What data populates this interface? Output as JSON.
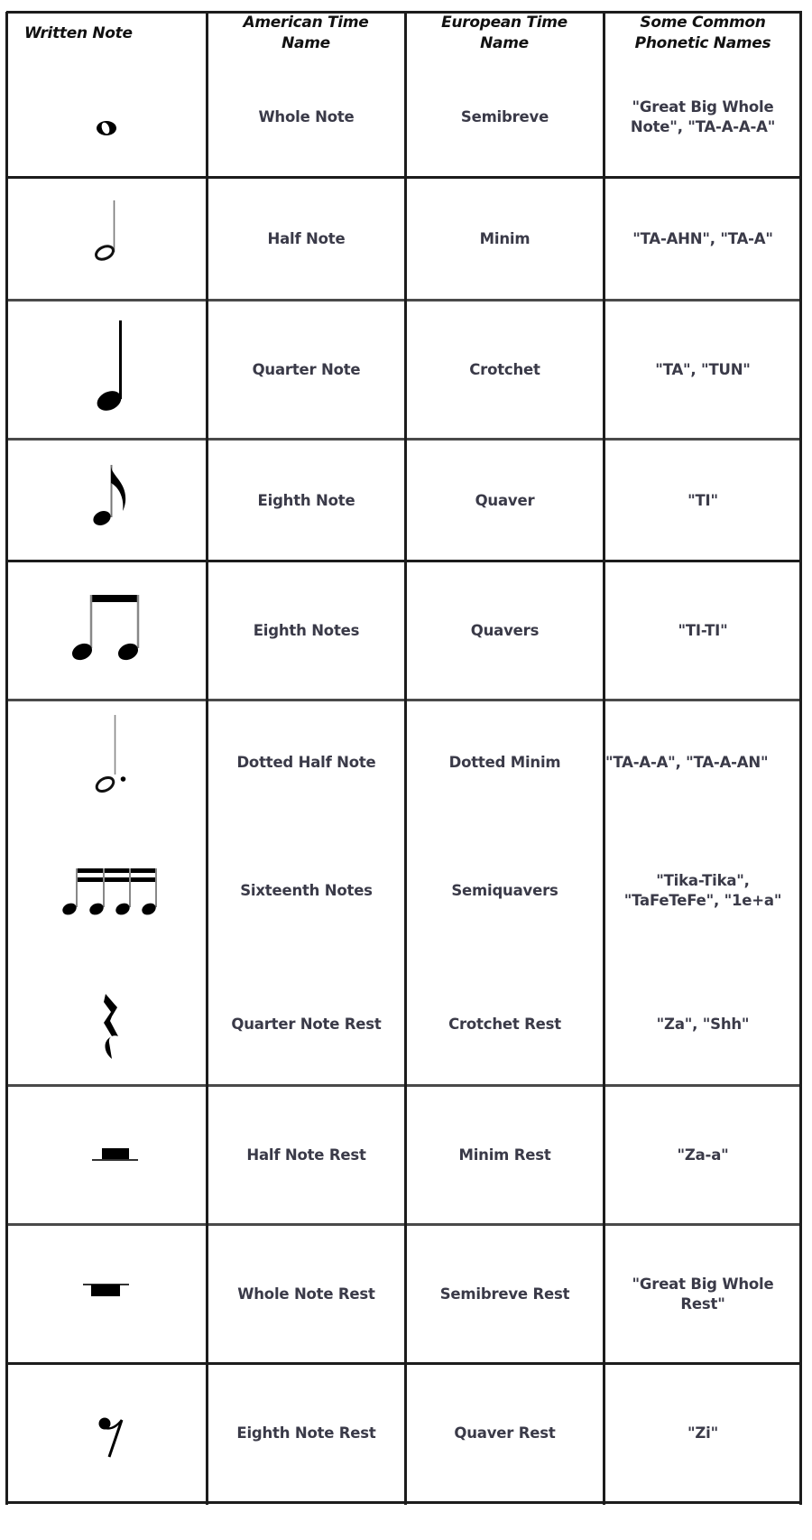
{
  "header": {
    "written_note": "Written Note",
    "american": "American Time Name",
    "european": "European Time Name",
    "phonetic": "Some Common Phonetic Names"
  },
  "rows": [
    {
      "icon": "whole-note-icon",
      "american": "Whole Note",
      "european": "Semibreve",
      "phonetic": "\"Great Big Whole Note\", \"TA-A-A-A\""
    },
    {
      "icon": "half-note-icon",
      "american": "Half Note",
      "european": "Minim",
      "phonetic": "\"TA-AHN\", \"TA-A\""
    },
    {
      "icon": "quarter-note-icon",
      "american": "Quarter Note",
      "european": "Crotchet",
      "phonetic": "\"TA\", \"TUN\""
    },
    {
      "icon": "eighth-note-icon",
      "american": "Eighth Note",
      "european": "Quaver",
      "phonetic": "\"TI\""
    },
    {
      "icon": "beamed-eighth-notes-icon",
      "american": "Eighth Notes",
      "european": "Quavers",
      "phonetic": "\"TI-TI\""
    },
    {
      "icon": "dotted-half-note-icon",
      "american": "Dotted Half Note",
      "european": "Dotted Minim",
      "phonetic": "\"TA-A-A\", \"TA-A-AN\""
    },
    {
      "icon": "sixteenth-notes-icon",
      "american": "Sixteenth Notes",
      "european": "Semiquavers",
      "phonetic": "\"Tika-Tika\", \"TaFeTeFe\", \"1e+a\""
    },
    {
      "icon": "quarter-rest-icon",
      "american": "Quarter Note Rest",
      "european": "Crotchet Rest",
      "phonetic": "\"Za\", \"Shh\""
    },
    {
      "icon": "half-rest-icon",
      "american": "Half Note Rest",
      "european": "Minim Rest",
      "phonetic": "\"Za-a\""
    },
    {
      "icon": "whole-rest-icon",
      "american": "Whole Note Rest",
      "european": "Semibreve Rest",
      "phonetic": "\"Great Big Whole Rest\""
    },
    {
      "icon": "eighth-rest-icon",
      "american": "Eighth Note Rest",
      "european": "Quaver Rest",
      "phonetic": "\"Zi\""
    }
  ]
}
